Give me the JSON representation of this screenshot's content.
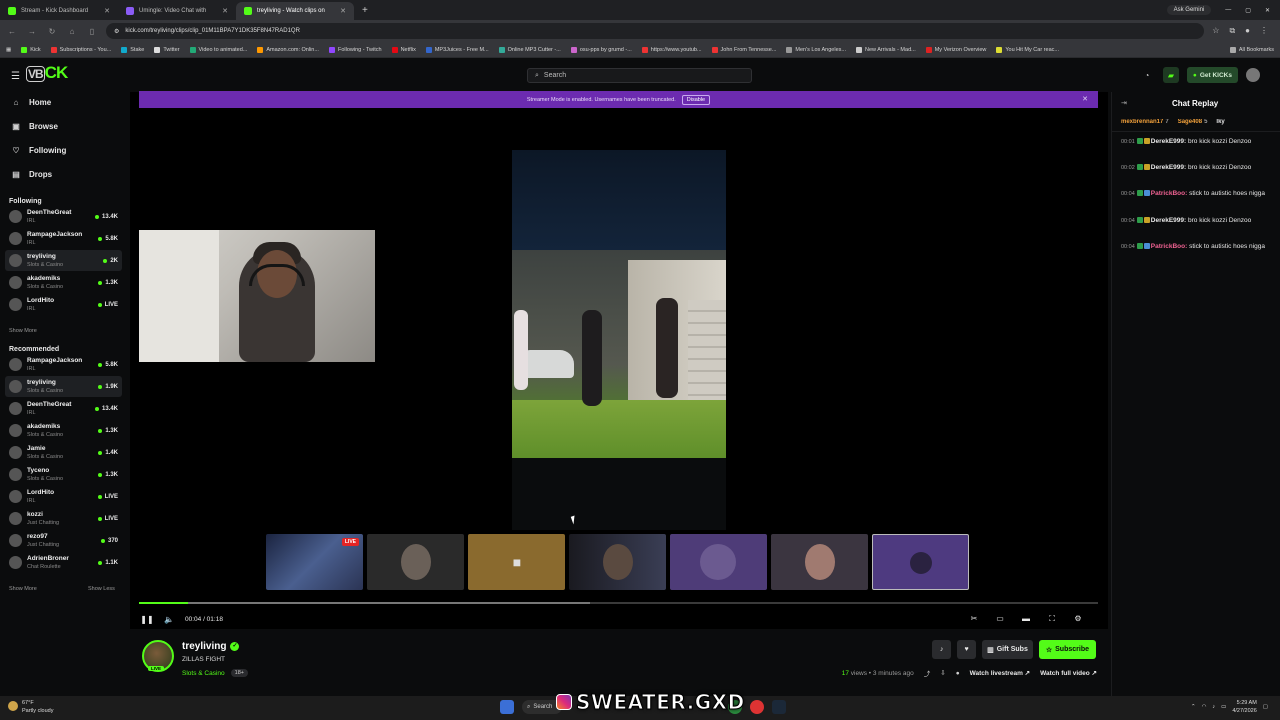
{
  "browser": {
    "tabs": [
      {
        "title": "Stream - Kick Dashboard",
        "active": false
      },
      {
        "title": "Umingle: Video Chat with",
        "active": false
      },
      {
        "title": "treyliving - Watch clips on",
        "active": true
      }
    ],
    "url": "kick.com/treyliving/clips/clip_01M11BPA7Y1DK35F8N47RAD1QR",
    "ask_gemini": "Ask Gemini",
    "bookmarks": [
      "Kick",
      "Subscriptions - You...",
      "Stake",
      "Twitter",
      "Video to animated...",
      "Amazon.com: Onlin...",
      "Following - Twitch",
      "Netflix",
      "MP3Juices - Free M...",
      "Online MP3 Cutter -...",
      "osu-pps by grumd -...",
      "https://www.youtub...",
      "John From Tennesse...",
      "Men's Los Angeles...",
      "New Arrivals - Mad...",
      "My Verizon Overview",
      "You Hit My Car reac..."
    ],
    "all_bookmarks": "All Bookmarks"
  },
  "header": {
    "logo_prefix": "VB",
    "logo_text": "CK",
    "search_placeholder": "Search",
    "get_kicks": "Get KICKs"
  },
  "sidebar": {
    "nav": [
      {
        "label": "Home",
        "icon": "home-icon",
        "glyph": "⌂"
      },
      {
        "label": "Browse",
        "icon": "browse-icon",
        "glyph": "▣"
      },
      {
        "label": "Following",
        "icon": "heart-icon",
        "glyph": "♡"
      },
      {
        "label": "Drops",
        "icon": "gift-icon",
        "glyph": "▤"
      }
    ],
    "following_title": "Following",
    "following": [
      {
        "name": "DeenTheGreat",
        "category": "IRL",
        "count": "13.4K"
      },
      {
        "name": "RampageJackson",
        "category": "IRL",
        "count": "5.8K"
      },
      {
        "name": "treyliving",
        "category": "Slots & Casino",
        "count": "2K"
      },
      {
        "name": "akademiks",
        "category": "Slots & Casino",
        "count": "1.3K"
      },
      {
        "name": "LordHito",
        "category": "IRL",
        "count": "LIVE"
      }
    ],
    "show_more": "Show More",
    "recommended_title": "Recommended",
    "recommended": [
      {
        "name": "RampageJackson",
        "category": "IRL",
        "count": "5.8K"
      },
      {
        "name": "treyliving",
        "category": "Slots & Casino",
        "count": "1.9K"
      },
      {
        "name": "DeenTheGreat",
        "category": "IRL",
        "count": "13.4K"
      },
      {
        "name": "akademiks",
        "category": "Slots & Casino",
        "count": "1.3K"
      },
      {
        "name": "Jamie",
        "category": "Slots & Casino",
        "count": "1.4K"
      },
      {
        "name": "Tyceno",
        "category": "Slots & Casino",
        "count": "1.3K"
      },
      {
        "name": "LordHito",
        "category": "IRL",
        "count": "LIVE"
      },
      {
        "name": "kozzi",
        "category": "Just Chatting",
        "count": "LIVE"
      },
      {
        "name": "rezo97",
        "category": "Just Chatting",
        "count": "370"
      },
      {
        "name": "AdrienBroner",
        "category": "Chat Roulette",
        "count": "1.1K"
      }
    ],
    "show_more_2": "Show More",
    "show_less": "Show Less"
  },
  "player": {
    "banner_text": "Streamer Mode is enabled. Usernames have been truncated.",
    "banner_button": "Disable",
    "live_badge": "LIVE",
    "time": "00:04 / 01:18",
    "progress": 0.051,
    "buffered": 0.47
  },
  "channel": {
    "name": "treyliving",
    "clip_title": "ZILLAS FIGHT",
    "category": "Slots & Casino",
    "age": "18+",
    "live_pill": "LIVE",
    "gift_subs": "Gift Subs",
    "subscribe": "Subscribe",
    "views_count": "17",
    "views_suffix": "views • 3 minutes ago",
    "watch_livestream": "Watch livestream",
    "watch_full_video": "Watch full video"
  },
  "chat": {
    "title": "Chat Replay",
    "gifters": [
      {
        "name": "mexbrennan17",
        "count": "7",
        "color": "#f2a13b"
      },
      {
        "name": "Sage408",
        "count": "5",
        "color": "#f2a13b"
      },
      {
        "name": "lky",
        "count": "",
        "color": "#e8e8e8"
      }
    ],
    "messages": [
      {
        "time": "00:01",
        "user": "DerekE999:",
        "text": "bro kick kozzi Denzoo",
        "color": "#e8e8e8"
      },
      {
        "time": "00:02",
        "user": "DerekE999:",
        "text": "bro kick kozzi Denzoo",
        "color": "#e8e8e8"
      },
      {
        "time": "00:04",
        "user": "PatrickBoo:",
        "text": "stick to autistic hoes nigga",
        "color": "#f06292"
      },
      {
        "time": "00:04",
        "user": "DerekE999:",
        "text": "bro kick kozzi Denzoo",
        "color": "#e8e8e8"
      },
      {
        "time": "00:04",
        "user": "PatrickBoo:",
        "text": "stick to autistic hoes nigga",
        "color": "#f06292"
      }
    ]
  },
  "taskbar": {
    "temp": "67°F",
    "weather": "Partly cloudy",
    "search": "Search",
    "watermark": "SWEATER.GXD",
    "time": "5:29 AM",
    "date": "4/27/2026"
  },
  "colors": {
    "accent": "#53fc18",
    "banner": "#6c2bb0",
    "chrome": "#35363a"
  }
}
